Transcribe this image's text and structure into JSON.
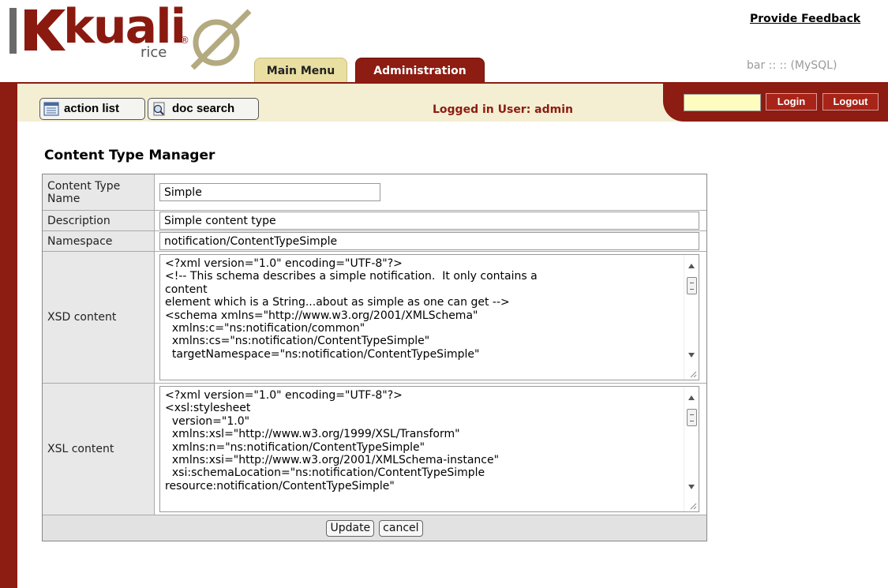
{
  "header": {
    "logo": {
      "wordmark": "kuali",
      "sub": "rice"
    },
    "feedback_link": "Provide Feedback",
    "server_info": "bar :: :: (MySQL)",
    "tabs": [
      {
        "label": "Main Menu",
        "active": false
      },
      {
        "label": "Administration",
        "active": true
      }
    ]
  },
  "toolbar": {
    "action_list": "action list",
    "doc_search": "doc search",
    "logged_in": "Logged in User: admin",
    "login_field": "",
    "login_button": "Login",
    "logout_button": "Logout"
  },
  "page": {
    "title": "Content Type Manager",
    "fields": {
      "name": {
        "label": "Content Type Name",
        "value": "Simple"
      },
      "description": {
        "label": "Description",
        "value": "Simple content type"
      },
      "namespace": {
        "label": "Namespace",
        "value": "notification/ContentTypeSimple"
      },
      "xsd": {
        "label": "XSD content",
        "value": "<?xml version=\"1.0\" encoding=\"UTF-8\"?>\n<!-- This schema describes a simple notification.  It only contains a\ncontent\nelement which is a String...about as simple as one can get -->\n<schema xmlns=\"http://www.w3.org/2001/XMLSchema\"\n  xmlns:c=\"ns:notification/common\"\n  xmlns:cs=\"ns:notification/ContentTypeSimple\"\n  targetNamespace=\"ns:notification/ContentTypeSimple\""
      },
      "xsl": {
        "label": "XSL content",
        "value": "<?xml version=\"1.0\" encoding=\"UTF-8\"?>\n<xsl:stylesheet\n  version=\"1.0\"\n  xmlns:xsl=\"http://www.w3.org/1999/XSL/Transform\"\n  xmlns:n=\"ns:notification/ContentTypeSimple\"\n  xmlns:xsi=\"http://www.w3.org/2001/XMLSchema-instance\"\n  xsi:schemaLocation=\"ns:notification/ContentTypeSimple\nresource:notification/ContentTypeSimple\""
      }
    },
    "buttons": {
      "update": "Update",
      "cancel": "cancel"
    }
  },
  "colors": {
    "brand_red": "#8d1c12",
    "cream": "#f4efd3",
    "tab_gold": "#e9dfa2",
    "login_field_bg": "#fffcc0"
  },
  "icons": [
    "action-list-icon",
    "doc-search-icon",
    "scroll-up-icon",
    "scroll-down-icon",
    "resize-grip-icon"
  ]
}
